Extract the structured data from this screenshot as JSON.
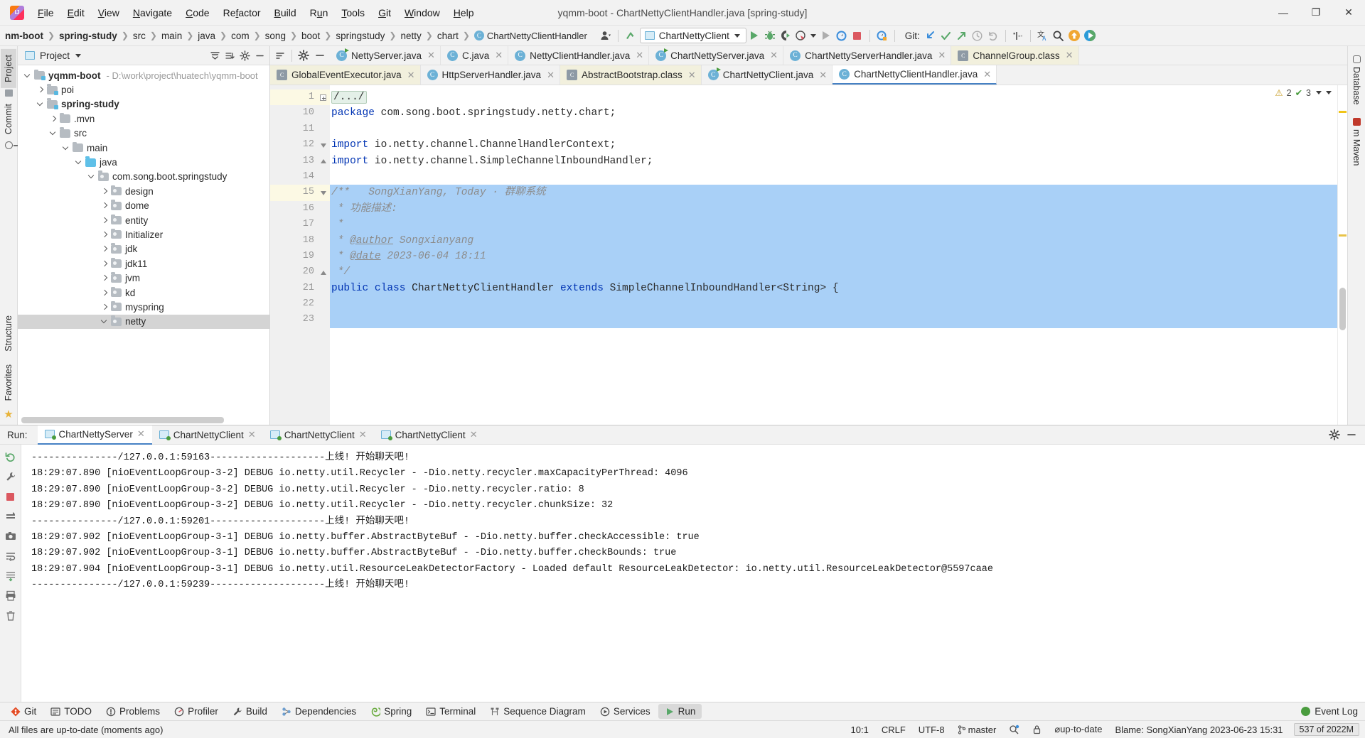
{
  "window": {
    "title": "yqmm-boot - ChartNettyClientHandler.java [spring-study]",
    "minimize": "—",
    "maximize": "❐",
    "close": "✕"
  },
  "menubar": [
    {
      "label": "File"
    },
    {
      "label": "Edit"
    },
    {
      "label": "View"
    },
    {
      "label": "Navigate"
    },
    {
      "label": "Code"
    },
    {
      "label": "Refactor"
    },
    {
      "label": "Build"
    },
    {
      "label": "Run"
    },
    {
      "label": "Tools"
    },
    {
      "label": "Git"
    },
    {
      "label": "Window"
    },
    {
      "label": "Help"
    }
  ],
  "breadcrumbs": [
    {
      "label": "nm-boot",
      "bold": true
    },
    {
      "label": "spring-study",
      "bold": true
    },
    {
      "label": "src"
    },
    {
      "label": "main"
    },
    {
      "label": "java"
    },
    {
      "label": "com"
    },
    {
      "label": "song"
    },
    {
      "label": "boot"
    },
    {
      "label": "springstudy"
    },
    {
      "label": "netty"
    },
    {
      "label": "chart"
    }
  ],
  "breadcrumb_class": "ChartNettyClientHandler",
  "toolbar": {
    "run_config": "ChartNettyClient",
    "git_label": "Git:"
  },
  "project_panel": {
    "title": "Project",
    "tree": [
      {
        "depth": 0,
        "label": "yqmm-boot",
        "bold": true,
        "path": "- D:\\work\\project\\huatech\\yqmm-boot",
        "arrow": "open",
        "icon": "module"
      },
      {
        "depth": 1,
        "label": "poi",
        "arrow": "closed",
        "icon": "module"
      },
      {
        "depth": 1,
        "label": "spring-study",
        "bold": true,
        "arrow": "open",
        "icon": "module"
      },
      {
        "depth": 2,
        "label": ".mvn",
        "arrow": "closed",
        "icon": "folder"
      },
      {
        "depth": 2,
        "label": "src",
        "arrow": "open",
        "icon": "folder"
      },
      {
        "depth": 3,
        "label": "main",
        "arrow": "open",
        "icon": "folder"
      },
      {
        "depth": 4,
        "label": "java",
        "arrow": "open",
        "icon": "source"
      },
      {
        "depth": 5,
        "label": "com.song.boot.springstudy",
        "arrow": "open",
        "icon": "package"
      },
      {
        "depth": 6,
        "label": "design",
        "arrow": "closed",
        "icon": "package"
      },
      {
        "depth": 6,
        "label": "dome",
        "arrow": "closed",
        "icon": "package"
      },
      {
        "depth": 6,
        "label": "entity",
        "arrow": "closed",
        "icon": "package"
      },
      {
        "depth": 6,
        "label": "Initializer",
        "arrow": "closed",
        "icon": "package"
      },
      {
        "depth": 6,
        "label": "jdk",
        "arrow": "closed",
        "icon": "package"
      },
      {
        "depth": 6,
        "label": "jdk11",
        "arrow": "closed",
        "icon": "package"
      },
      {
        "depth": 6,
        "label": "jvm",
        "arrow": "closed",
        "icon": "package"
      },
      {
        "depth": 6,
        "label": "kd",
        "arrow": "closed",
        "icon": "package"
      },
      {
        "depth": 6,
        "label": "myspring",
        "arrow": "closed",
        "icon": "package"
      },
      {
        "depth": 6,
        "label": "netty",
        "arrow": "open",
        "icon": "package",
        "selected": true
      }
    ]
  },
  "editor_tabs_row1": [
    {
      "label": "NettyServer.java",
      "icon": "java-run",
      "state": "normal"
    },
    {
      "label": "C.java",
      "icon": "java",
      "state": "normal"
    },
    {
      "label": "NettyClientHandler.java",
      "icon": "java",
      "state": "normal"
    },
    {
      "label": "ChartNettyServer.java",
      "icon": "java-run",
      "state": "normal"
    },
    {
      "label": "ChartNettyServerHandler.java",
      "icon": "java",
      "state": "normal"
    },
    {
      "label": "ChannelGroup.class",
      "icon": "class-lib",
      "state": "yellow"
    }
  ],
  "editor_tabs_row2": [
    {
      "label": "GlobalEventExecutor.java",
      "icon": "class-lib",
      "state": "yellow"
    },
    {
      "label": "HttpServerHandler.java",
      "icon": "java",
      "state": "normal"
    },
    {
      "label": "AbstractBootstrap.class",
      "icon": "class-lib",
      "state": "yellow"
    },
    {
      "label": "ChartNettyClient.java",
      "icon": "java-run",
      "state": "normal"
    },
    {
      "label": "ChartNettyClientHandler.java",
      "icon": "java",
      "state": "active"
    }
  ],
  "inspections": {
    "warnings": "2",
    "checks": "3"
  },
  "code": {
    "lines": [
      {
        "num": "1",
        "fold": "plus",
        "highlight": false,
        "current": true,
        "tokens": [
          {
            "t": "foldmark",
            "v": "/.../"
          }
        ]
      },
      {
        "num": "10",
        "fold": "",
        "highlight": false,
        "tokens": [
          {
            "t": "kw",
            "v": "package"
          },
          {
            "t": "plain",
            "v": " com.song.boot.springstudy.netty.chart;"
          }
        ]
      },
      {
        "num": "11",
        "fold": "",
        "highlight": false,
        "tokens": []
      },
      {
        "num": "12",
        "fold": "down",
        "highlight": false,
        "tokens": [
          {
            "t": "kw",
            "v": "import"
          },
          {
            "t": "plain",
            "v": " io.netty.channel.ChannelHandlerContext;"
          }
        ]
      },
      {
        "num": "13",
        "fold": "up",
        "highlight": false,
        "tokens": [
          {
            "t": "kw",
            "v": "import"
          },
          {
            "t": "plain",
            "v": " io.netty.channel.SimpleChannelInboundHandler;"
          }
        ]
      },
      {
        "num": "14",
        "fold": "",
        "highlight": false,
        "tokens": []
      },
      {
        "num": "15",
        "fold": "down",
        "highlight": true,
        "current": true,
        "tokens": [
          {
            "t": "com",
            "v": "/**   SongXianYang, Today · 群聊系统"
          }
        ]
      },
      {
        "num": "16",
        "fold": "",
        "highlight": true,
        "tokens": [
          {
            "t": "com",
            "v": " * 功能描述:"
          }
        ]
      },
      {
        "num": "17",
        "fold": "",
        "highlight": true,
        "tokens": [
          {
            "t": "com",
            "v": " *"
          }
        ]
      },
      {
        "num": "18",
        "fold": "",
        "highlight": true,
        "tokens": [
          {
            "t": "com",
            "v": " * "
          },
          {
            "t": "tag",
            "v": "@author"
          },
          {
            "t": "com",
            "v": " Songxianyang"
          }
        ]
      },
      {
        "num": "19",
        "fold": "",
        "highlight": true,
        "tokens": [
          {
            "t": "com",
            "v": " * "
          },
          {
            "t": "tag",
            "v": "@date"
          },
          {
            "t": "com",
            "v": " 2023-06-04 18:11"
          }
        ]
      },
      {
        "num": "20",
        "fold": "up",
        "highlight": true,
        "tokens": [
          {
            "t": "com",
            "v": " */"
          }
        ]
      },
      {
        "num": "21",
        "fold": "",
        "highlight": true,
        "tokens": [
          {
            "t": "kw",
            "v": "public"
          },
          {
            "t": "plain",
            "v": " "
          },
          {
            "t": "kw",
            "v": "class"
          },
          {
            "t": "plain",
            "v": " ChartNettyClientHandler "
          },
          {
            "t": "kw",
            "v": "extends"
          },
          {
            "t": "plain",
            "v": " SimpleChannelInboundHandler<String> {"
          }
        ]
      },
      {
        "num": "22",
        "fold": "",
        "highlight": true,
        "tokens": []
      },
      {
        "num": "23",
        "fold": "",
        "highlight": true,
        "tokens": []
      }
    ]
  },
  "run_panel": {
    "label": "Run:",
    "tabs": [
      {
        "label": "ChartNettyServer",
        "active": true
      },
      {
        "label": "ChartNettyClient",
        "active": false
      },
      {
        "label": "ChartNettyClient",
        "active": false
      },
      {
        "label": "ChartNettyClient",
        "active": false
      }
    ],
    "console": [
      "---------------/127.0.0.1:59163--------------------上线! 开始聊天吧!",
      "18:29:07.890 [nioEventLoopGroup-3-2] DEBUG io.netty.util.Recycler - -Dio.netty.recycler.maxCapacityPerThread: 4096",
      "18:29:07.890 [nioEventLoopGroup-3-2] DEBUG io.netty.util.Recycler - -Dio.netty.recycler.ratio: 8",
      "18:29:07.890 [nioEventLoopGroup-3-2] DEBUG io.netty.util.Recycler - -Dio.netty.recycler.chunkSize: 32",
      "---------------/127.0.0.1:59201--------------------上线! 开始聊天吧!",
      "18:29:07.902 [nioEventLoopGroup-3-1] DEBUG io.netty.buffer.AbstractByteBuf - -Dio.netty.buffer.checkAccessible: true",
      "18:29:07.902 [nioEventLoopGroup-3-1] DEBUG io.netty.buffer.AbstractByteBuf - -Dio.netty.buffer.checkBounds: true",
      "18:29:07.904 [nioEventLoopGroup-3-1] DEBUG io.netty.util.ResourceLeakDetectorFactory - Loaded default ResourceLeakDetector: io.netty.util.ResourceLeakDetector@5597caae",
      "---------------/127.0.0.1:59239--------------------上线! 开始聊天吧!"
    ]
  },
  "left_rail": [
    {
      "label": "Project",
      "active": true
    },
    {
      "label": "Commit",
      "active": false
    }
  ],
  "left_rail_bottom": [
    {
      "label": "Structure"
    },
    {
      "label": "Favorites"
    }
  ],
  "right_rail": [
    {
      "label": "Database"
    },
    {
      "label": "m Maven"
    }
  ],
  "tool_windows": [
    {
      "label": "Git",
      "icon": "git-icon",
      "active": false
    },
    {
      "label": "TODO",
      "icon": "todo-icon",
      "active": false
    },
    {
      "label": "Problems",
      "icon": "problems-icon",
      "active": false
    },
    {
      "label": "Profiler",
      "icon": "profiler-icon",
      "active": false
    },
    {
      "label": "Build",
      "icon": "build-icon",
      "active": false
    },
    {
      "label": "Dependencies",
      "icon": "dependencies-icon",
      "active": false
    },
    {
      "label": "Spring",
      "icon": "spring-icon",
      "active": false
    },
    {
      "label": "Terminal",
      "icon": "terminal-icon",
      "active": false
    },
    {
      "label": "Sequence Diagram",
      "icon": "sequence-diagram-icon",
      "active": false
    },
    {
      "label": "Services",
      "icon": "services-icon",
      "active": false
    },
    {
      "label": "Run",
      "icon": "run-icon",
      "active": true
    }
  ],
  "event_log": "Event Log",
  "status_bar": {
    "message": "All files are up-to-date (moments ago)",
    "caret": "10:1",
    "line_sep": "CRLF",
    "encoding": "UTF-8",
    "branch": "master",
    "vcs_status": "⌀up-to-date",
    "blame": "Blame: SongXianYang 2023-06-23 15:31",
    "memory": "537 of 2022M"
  },
  "colors": {
    "accent": "#4681c4",
    "selection": "#a9d0f7",
    "keyword": "#0033b3",
    "comment": "#8c8c8c",
    "green": "#4a9c3e",
    "panel": "#f2f2f2"
  }
}
